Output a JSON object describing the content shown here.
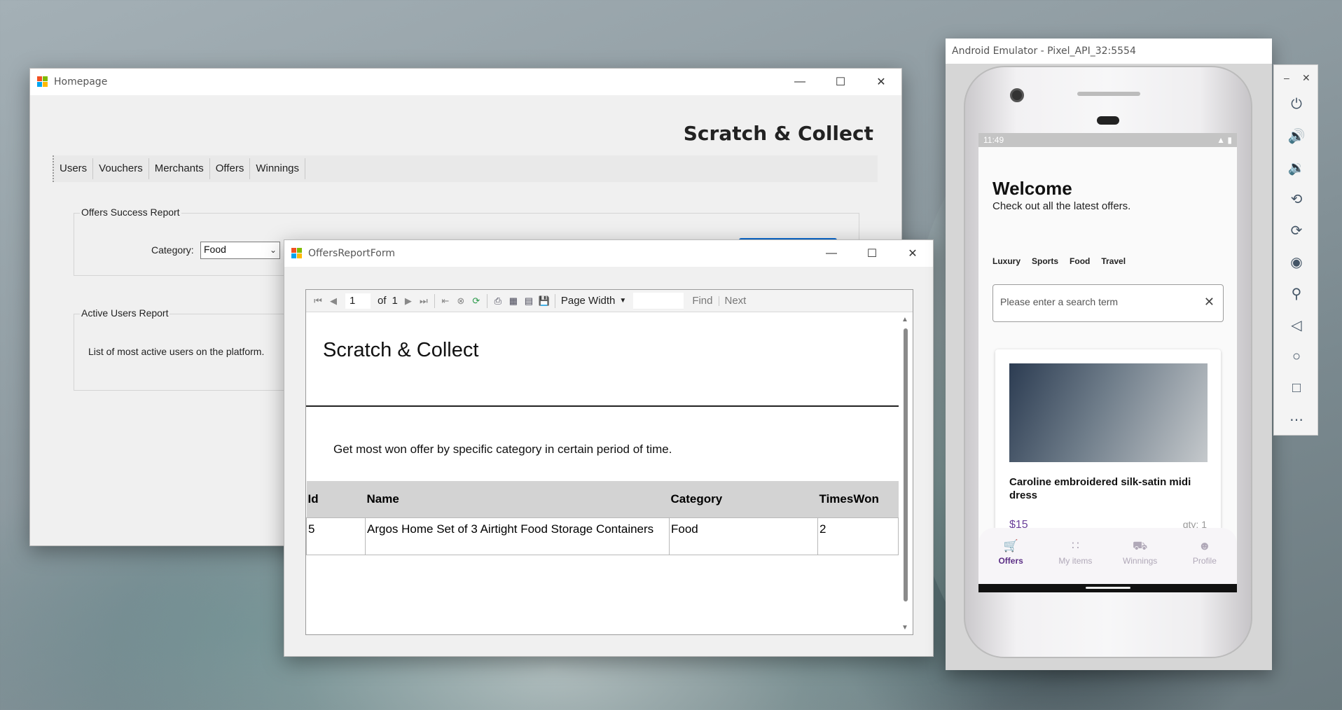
{
  "homepage": {
    "window_title": "Homepage",
    "brand": "Scratch & Collect",
    "menu": [
      "Users",
      "Vouchers",
      "Merchants",
      "Offers",
      "Winnings"
    ],
    "offers_group": {
      "legend": "Offers Success Report",
      "category_label": "Category:",
      "category_value": "Food"
    },
    "users_group": {
      "legend": "Active Users Report",
      "description": "List of most active users on the platform."
    }
  },
  "report_form": {
    "window_title": "OffersReportForm",
    "toolbar": {
      "page_current": "1",
      "of_label": "of",
      "page_total": "1",
      "zoom": "Page Width",
      "find_label": "Find",
      "next_label": "Next"
    },
    "report": {
      "title": "Scratch & Collect",
      "description": "Get most won offer by specific category in certain period of time.",
      "columns": [
        "Id",
        "Name",
        "Category",
        "TimesWon"
      ],
      "rows": [
        [
          "5",
          "Argos Home Set of 3 Airtight Food Storage Containers",
          "Food",
          "2"
        ]
      ]
    }
  },
  "emulator": {
    "window_title": "Android Emulator - Pixel_API_32:5554",
    "status_time": "11:49",
    "welcome": "Welcome",
    "welcome_sub": "Check out all the latest offers.",
    "categories": [
      "Luxury",
      "Sports",
      "Food",
      "Travel"
    ],
    "search_placeholder": "Please enter a search term",
    "card": {
      "name": "Caroline embroidered silk-satin midi dress",
      "price": "$15",
      "qty": "qty: 1"
    },
    "nav": [
      "Offers",
      "My items",
      "Winnings",
      "Profile"
    ],
    "accent_color": "#5c2f86"
  }
}
